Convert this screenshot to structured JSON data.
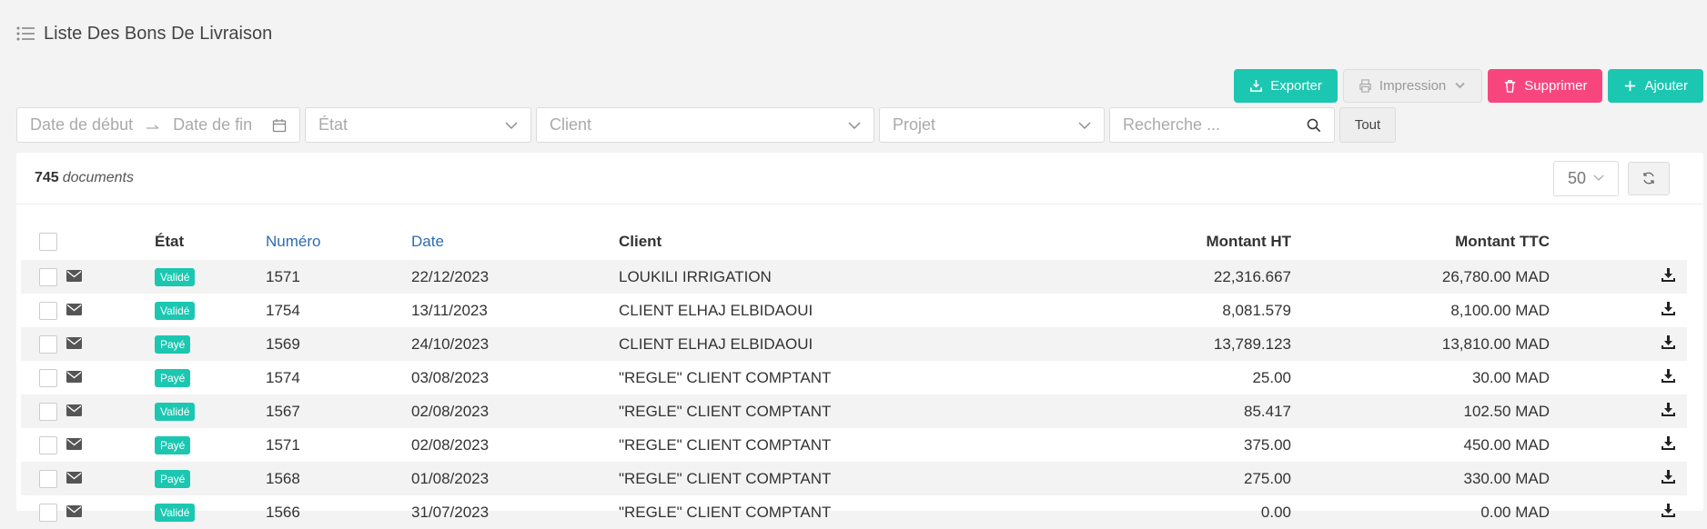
{
  "header": {
    "title": "Liste Des Bons De Livraison"
  },
  "toolbar": {
    "exporter": "Exporter",
    "impression": "Impression",
    "supprimer": "Supprimer",
    "ajouter": "Ajouter"
  },
  "filters": {
    "date_start": "Date de début",
    "date_end": "Date de fin",
    "etat": "État",
    "client": "Client",
    "projet": "Projet",
    "search": "Recherche ...",
    "tout": "Tout"
  },
  "summary": {
    "count": "745",
    "label": "documents",
    "page_size": "50"
  },
  "table": {
    "columns": [
      "État",
      "Numéro",
      "Date",
      "Client",
      "Montant HT",
      "Montant TTC"
    ],
    "rows": [
      {
        "etat": "Validé",
        "num": "1571",
        "date": "22/12/2023",
        "client": "LOUKILI IRRIGATION",
        "ht": "22,316.667",
        "ttc": "26,780.00 MAD"
      },
      {
        "etat": "Validé",
        "num": "1754",
        "date": "13/11/2023",
        "client": "CLIENT ELHAJ ELBIDAOUI",
        "ht": "8,081.579",
        "ttc": "8,100.00 MAD"
      },
      {
        "etat": "Payé",
        "num": "1569",
        "date": "24/10/2023",
        "client": "CLIENT ELHAJ ELBIDAOUI",
        "ht": "13,789.123",
        "ttc": "13,810.00 MAD"
      },
      {
        "etat": "Payé",
        "num": "1574",
        "date": "03/08/2023",
        "client": "\"REGLE\" CLIENT COMPTANT",
        "ht": "25.00",
        "ttc": "30.00 MAD"
      },
      {
        "etat": "Validé",
        "num": "1567",
        "date": "02/08/2023",
        "client": "\"REGLE\" CLIENT COMPTANT",
        "ht": "85.417",
        "ttc": "102.50 MAD"
      },
      {
        "etat": "Payé",
        "num": "1571",
        "date": "02/08/2023",
        "client": "\"REGLE\" CLIENT COMPTANT",
        "ht": "375.00",
        "ttc": "450.00 MAD"
      },
      {
        "etat": "Payé",
        "num": "1568",
        "date": "01/08/2023",
        "client": "\"REGLE\" CLIENT COMPTANT",
        "ht": "275.00",
        "ttc": "330.00 MAD"
      },
      {
        "etat": "Validé",
        "num": "1566",
        "date": "31/07/2023",
        "client": "\"REGLE\" CLIENT COMPTANT",
        "ht": "0.00",
        "ttc": "0.00 MAD"
      }
    ]
  },
  "colors": {
    "teal": "#1cc7b1",
    "pink": "#f7467e",
    "link": "#2a6cb4"
  }
}
